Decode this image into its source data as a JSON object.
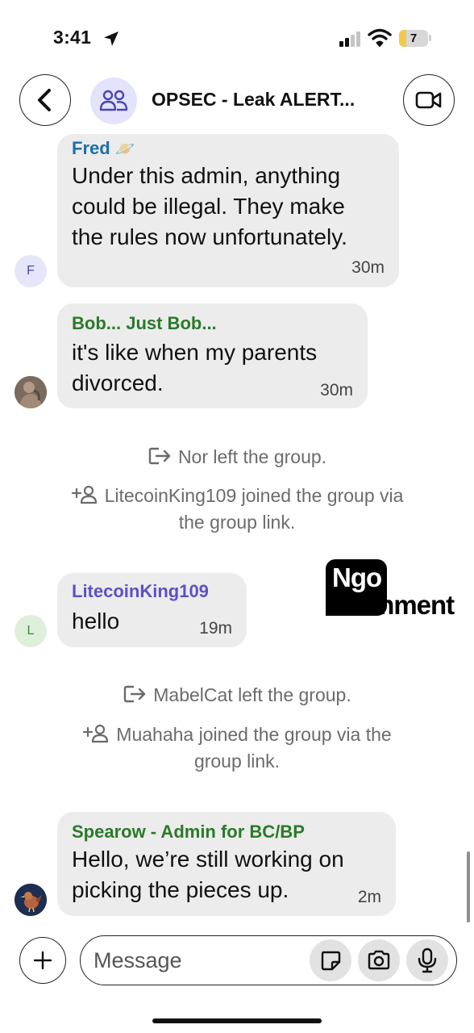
{
  "status_bar": {
    "time": "3:41",
    "battery": "7",
    "battery_color": "#f2c94c"
  },
  "header": {
    "title": "OPSEC - Leak ALERT...",
    "back_icon": "chevron-left-icon",
    "group_icon": "group-people-icon",
    "video_icon": "video-camera-icon"
  },
  "messages": [
    {
      "sender": "Fred",
      "sender_emoji": "🪐",
      "sender_color": "#1f6fa8",
      "text_lines": [
        "Under this admin, anything",
        "could be illegal. They make",
        "the rules now unfortunately."
      ],
      "time": "30m",
      "avatar_initial": "F",
      "avatar_color": "#e6e6fa"
    },
    {
      "sender": "Bob... Just Bob...",
      "sender_color": "#2a7a2a",
      "text_lines": [
        "it's like when my parents",
        "divorced."
      ],
      "time": "30m",
      "avatar_type": "photo"
    },
    {
      "sender": "LitecoinKing109",
      "sender_color": "#5a52c7",
      "text_lines": [
        "hello"
      ],
      "time": "19m",
      "avatar_initial": "L",
      "avatar_color": "#dff0da"
    },
    {
      "sender": "Spearow - Admin for BC/BP",
      "sender_color": "#2a7a2a",
      "text_lines": [
        "Hello, we’re still working on",
        "picking the pieces up."
      ],
      "time": "2m",
      "avatar_type": "bird-photo"
    }
  ],
  "events": [
    {
      "icon": "leave-icon",
      "lines": [
        "Nor left the group."
      ]
    },
    {
      "icon": "add-person-icon",
      "lines": [
        "LitecoinKing109 joined the group via",
        "the group link."
      ]
    },
    {
      "icon": "leave-icon",
      "lines": [
        "MabelCat left the group."
      ]
    },
    {
      "icon": "add-person-icon",
      "lines": [
        "Muahaha joined the group via the",
        "group link."
      ]
    }
  ],
  "watermark": {
    "line1": "Ngo",
    "line2": "Comment"
  },
  "composer": {
    "placeholder": "Message",
    "plus_icon": "plus-icon",
    "sticker_icon": "sticker-icon",
    "camera_icon": "camera-icon",
    "mic_icon": "microphone-icon"
  }
}
